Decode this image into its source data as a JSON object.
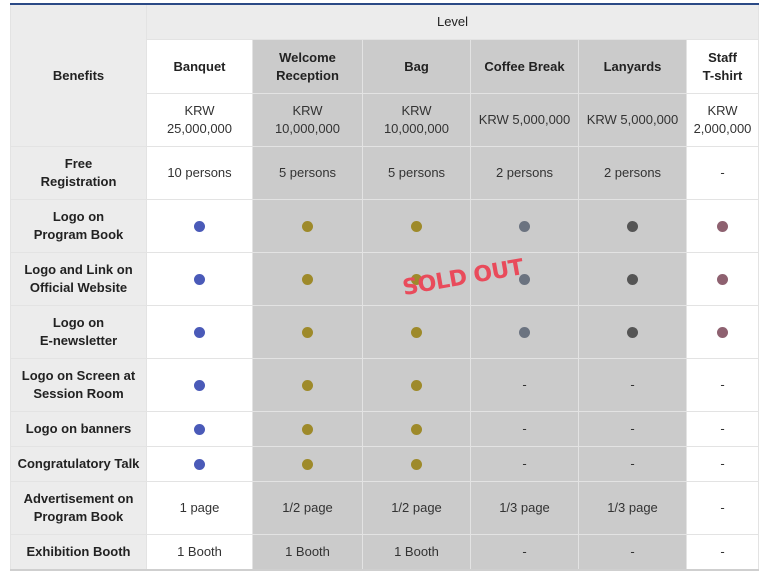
{
  "header": {
    "level": "Level",
    "benefits": "Benefits",
    "columns": [
      {
        "name": "Banquet",
        "price": "KRW\n25,000,000"
      },
      {
        "name": "Welcome\nReception",
        "price": "KRW\n10,000,000"
      },
      {
        "name": "Bag",
        "price": "KRW\n10,000,000"
      },
      {
        "name": "Coffee Break",
        "price": "KRW 5,000,000"
      },
      {
        "name": "Lanyards",
        "price": "KRW 5,000,000"
      },
      {
        "name": "Staff\nT-shirt",
        "price": "KRW\n2,000,000"
      }
    ]
  },
  "colors": {
    "blue": "#4a5ab8",
    "gold": "#9e8a2a",
    "slate": "#6b7380",
    "dark": "#555555",
    "mauve": "#8e6170",
    "header_rule": "#2b4a86",
    "sold_out": "#e94b5b"
  },
  "sold_out_label": "SOLD OUT",
  "rows": [
    {
      "benefit": "Free\nRegistration",
      "cells": [
        "10 persons",
        "5 persons",
        "5 persons",
        "2 persons",
        "2 persons",
        "-"
      ]
    },
    {
      "benefit": "Logo on\nProgram Book",
      "cells": [
        "dot:blue",
        "dot:gold",
        "dot:gold",
        "dot:slate",
        "dot:dark",
        "dot:mauve"
      ]
    },
    {
      "benefit": "Logo and Link on\nOfficial Website",
      "cells": [
        "dot:blue",
        "dot:gold",
        "dot:gold",
        "dot:slate",
        "dot:dark",
        "dot:mauve"
      ]
    },
    {
      "benefit": "Logo on\nE-newsletter",
      "cells": [
        "dot:blue",
        "dot:gold",
        "dot:gold",
        "dot:slate",
        "dot:dark",
        "dot:mauve"
      ]
    },
    {
      "benefit": "Logo on Screen at\nSession Room",
      "cells": [
        "dot:blue",
        "dot:gold",
        "dot:gold",
        "-",
        "-",
        "-"
      ]
    },
    {
      "benefit": "Logo on banners",
      "cells": [
        "dot:blue",
        "dot:gold",
        "dot:gold",
        "-",
        "-",
        "-"
      ]
    },
    {
      "benefit": "Congratulatory Talk",
      "cells": [
        "dot:blue",
        "dot:gold",
        "dot:gold",
        "-",
        "-",
        "-"
      ]
    },
    {
      "benefit": "Advertisement on\nProgram Book",
      "cells": [
        "1 page",
        "1/2 page",
        "1/2 page",
        "1/3 page",
        "1/3 page",
        "-"
      ]
    },
    {
      "benefit": "Exhibition Booth",
      "cells": [
        "1 Booth",
        "1 Booth",
        "1 Booth",
        "-",
        "-",
        "-"
      ]
    }
  ]
}
